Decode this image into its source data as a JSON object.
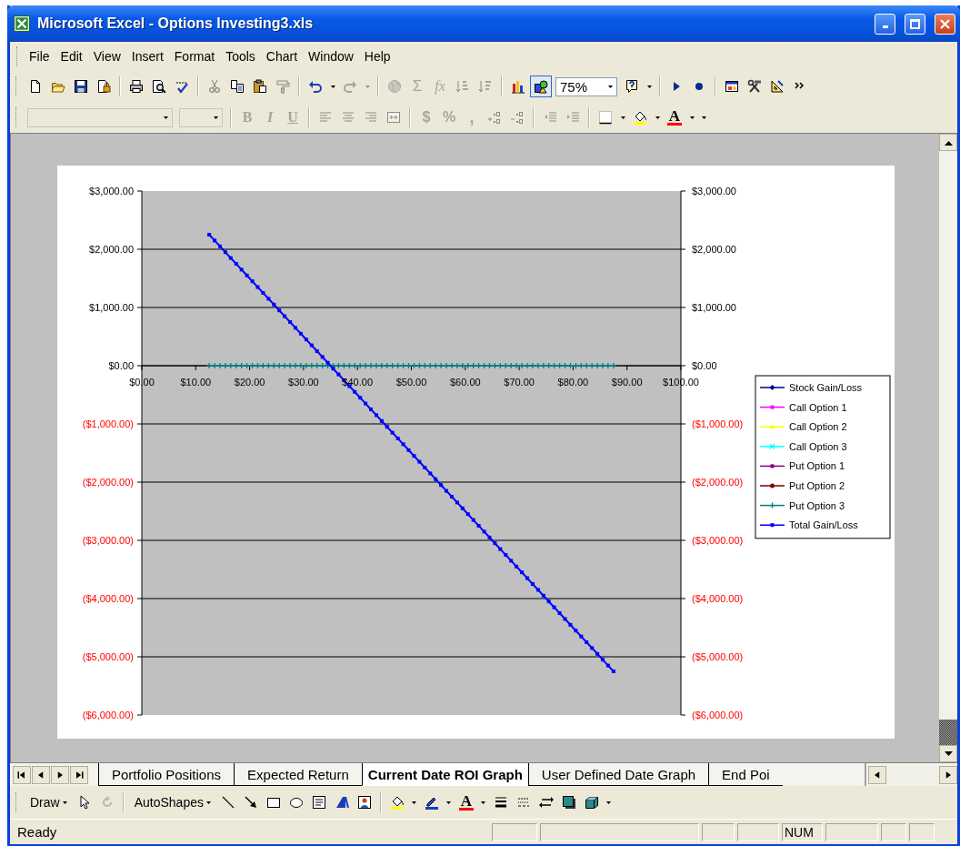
{
  "window": {
    "title": "Microsoft Excel - Options Investing3.xls"
  },
  "menu": [
    {
      "label": "File"
    },
    {
      "label": "Edit"
    },
    {
      "label": "View"
    },
    {
      "label": "Insert"
    },
    {
      "label": "Format"
    },
    {
      "label": "Tools"
    },
    {
      "label": "Chart"
    },
    {
      "label": "Window"
    },
    {
      "label": "Help"
    }
  ],
  "standard_toolbar": [
    {
      "disabled": false,
      "pressed": false
    },
    {
      "disabled": false,
      "pressed": false
    },
    {
      "disabled": false,
      "pressed": false
    },
    {
      "disabled": false,
      "pressed": false
    },
    {
      "disabled": false,
      "pressed": false
    },
    {
      "disabled": false,
      "pressed": false
    },
    {
      "disabled": false,
      "pressed": false
    },
    {
      "disabled": true,
      "pressed": false
    },
    {
      "disabled": false,
      "pressed": false
    },
    {
      "disabled": false,
      "pressed": false
    },
    {
      "disabled": true,
      "pressed": false
    },
    {
      "disabled": false,
      "pressed": false
    },
    {
      "disabled": false,
      "pressed": false
    },
    {
      "disabled": true,
      "pressed": false
    },
    {
      "disabled": true,
      "pressed": false
    },
    {
      "disabled": true,
      "pressed": false
    },
    {
      "label": "Σ",
      "disabled": true,
      "pressed": false
    },
    {
      "label": "fx",
      "disabled": true,
      "pressed": false
    },
    {
      "disabled": true,
      "pressed": false
    },
    {
      "disabled": true,
      "pressed": false
    },
    {
      "disabled": false,
      "pressed": false
    },
    {
      "disabled": false,
      "pressed": true
    },
    {
      "label": "75%",
      "disabled": false
    },
    {
      "disabled": false,
      "pressed": false
    },
    {
      "disabled": false,
      "pressed": false
    },
    {
      "disabled": false,
      "pressed": false
    },
    {
      "disabled": false,
      "pressed": false
    },
    {
      "disabled": false,
      "pressed": false
    },
    {
      "disabled": false,
      "pressed": false
    },
    {
      "disabled": false,
      "pressed": false
    },
    {
      "disabled": false,
      "pressed": false
    }
  ],
  "formatting_toolbar": [
    {
      "disabled": true
    },
    {
      "disabled": true
    },
    {
      "label": "B",
      "disabled": true
    },
    {
      "label": "I",
      "disabled": true
    },
    {
      "label": "U",
      "disabled": true
    },
    {
      "disabled": true
    },
    {
      "disabled": true
    },
    {
      "disabled": true
    },
    {
      "disabled": true
    },
    {
      "label": "$",
      "disabled": true
    },
    {
      "label": "%",
      "disabled": true
    },
    {
      "label": ",",
      "disabled": true
    },
    {
      "disabled": true
    },
    {
      "disabled": true
    },
    {
      "disabled": true
    },
    {
      "disabled": true
    },
    {
      "disabled": false
    },
    {
      "disabled": false
    },
    {
      "disabled": false
    },
    {
      "disabled": false
    },
    {
      "label": "A",
      "disabled": false
    },
    {
      "disabled": false
    },
    {
      "disabled": false
    }
  ],
  "chart": {
    "chart_data": {
      "type": "line",
      "x": [
        12.5,
        13.5,
        14.5,
        15.5,
        16.5,
        17.5,
        18.5,
        19.5,
        20.5,
        21.5,
        22.5,
        23.5,
        24.5,
        25.5,
        26.5,
        27.5,
        28.5,
        29.5,
        30.5,
        31.5,
        32.5,
        33.5,
        34.5,
        35.5,
        36.5,
        37.5,
        38.5,
        39.5,
        40.5,
        41.5,
        42.5,
        43.5,
        44.5,
        45.5,
        46.5,
        47.5,
        48.5,
        49.5,
        50.5,
        51.5,
        52.5,
        53.5,
        54.5,
        55.5,
        56.5,
        57.5,
        58.5,
        59.5,
        60.5,
        61.5,
        62.5,
        63.5,
        64.5,
        65.5,
        66.5,
        67.5,
        68.5,
        69.5,
        70.5,
        71.5,
        72.5,
        73.5,
        74.5,
        75.5,
        76.5,
        77.5,
        78.5,
        79.5,
        80.5,
        81.5,
        82.5,
        83.5,
        84.5,
        85.5,
        86.5,
        87.5
      ],
      "series": [
        {
          "name": "Stock Gain/Loss",
          "color": "#000080",
          "marker": "diamond",
          "values": [
            null,
            null,
            null,
            null,
            null,
            null,
            null,
            null,
            null,
            null,
            null,
            null,
            null,
            null,
            null,
            null,
            null,
            null,
            null,
            null,
            null,
            null,
            null,
            null,
            null,
            null,
            null,
            null,
            null,
            null,
            null,
            null,
            null,
            null,
            null,
            null,
            null,
            null,
            null,
            null,
            null,
            null,
            null,
            null,
            null,
            null,
            null,
            null,
            null,
            null,
            null,
            null,
            null,
            null,
            null,
            null,
            null,
            null,
            null,
            null,
            null,
            null,
            null,
            null,
            null,
            null,
            null,
            null,
            null,
            null,
            null,
            null,
            null,
            null,
            null,
            null
          ]
        },
        {
          "name": "Call Option 1",
          "color": "#ff00ff",
          "marker": "square",
          "values": [
            null,
            null,
            null,
            null,
            null,
            null,
            null,
            null,
            null,
            null,
            null,
            null,
            null,
            null,
            null,
            null,
            null,
            null,
            null,
            null,
            null,
            null,
            null,
            null,
            null,
            null,
            null,
            null,
            null,
            null,
            null,
            null,
            null,
            null,
            null,
            null,
            null,
            null,
            null,
            null,
            null,
            null,
            null,
            null,
            null,
            null,
            null,
            null,
            null,
            null,
            null,
            null,
            null,
            null,
            null,
            null,
            null,
            null,
            null,
            null,
            null,
            null,
            null,
            null,
            null,
            null,
            null,
            null,
            null,
            null,
            null,
            null,
            null,
            null,
            null,
            null
          ]
        },
        {
          "name": "Call Option 2",
          "color": "#ffff00",
          "marker": "triangle",
          "values": [
            null,
            null,
            null,
            null,
            null,
            null,
            null,
            null,
            null,
            null,
            null,
            null,
            null,
            null,
            null,
            null,
            null,
            null,
            null,
            null,
            null,
            null,
            null,
            null,
            null,
            null,
            null,
            null,
            null,
            null,
            null,
            null,
            null,
            null,
            null,
            null,
            null,
            null,
            null,
            null,
            null,
            null,
            null,
            null,
            null,
            null,
            null,
            null,
            null,
            null,
            null,
            null,
            null,
            null,
            null,
            null,
            null,
            null,
            null,
            null,
            null,
            null,
            null,
            null,
            null,
            null,
            null,
            null,
            null,
            null,
            null,
            null,
            null,
            null,
            null,
            null
          ]
        },
        {
          "name": "Call Option 3",
          "color": "#00ffff",
          "marker": "star",
          "values": [
            null,
            null,
            null,
            null,
            null,
            null,
            null,
            null,
            null,
            null,
            null,
            null,
            null,
            null,
            null,
            null,
            null,
            null,
            null,
            null,
            null,
            null,
            null,
            null,
            null,
            null,
            null,
            null,
            null,
            null,
            null,
            null,
            null,
            null,
            null,
            null,
            null,
            null,
            null,
            null,
            null,
            null,
            null,
            null,
            null,
            null,
            null,
            null,
            null,
            null,
            null,
            null,
            null,
            null,
            null,
            null,
            null,
            null,
            null,
            null,
            null,
            null,
            null,
            null,
            null,
            null,
            null,
            null,
            null,
            null,
            null,
            null,
            null,
            null,
            null,
            null
          ]
        },
        {
          "name": "Put Option 1",
          "color": "#800080",
          "marker": "square",
          "values": [
            null,
            null,
            null,
            null,
            null,
            null,
            null,
            null,
            null,
            null,
            null,
            null,
            null,
            null,
            null,
            null,
            null,
            null,
            null,
            null,
            null,
            null,
            null,
            null,
            null,
            null,
            null,
            null,
            null,
            null,
            null,
            null,
            null,
            null,
            null,
            null,
            null,
            null,
            null,
            null,
            null,
            null,
            null,
            null,
            null,
            null,
            null,
            null,
            null,
            null,
            null,
            null,
            null,
            null,
            null,
            null,
            null,
            null,
            null,
            null,
            null,
            null,
            null,
            null,
            null,
            null,
            null,
            null,
            null,
            null,
            null,
            null,
            null,
            null,
            null,
            null
          ]
        },
        {
          "name": "Put Option 2",
          "color": "#800000",
          "marker": "circle",
          "values": [
            null,
            null,
            null,
            null,
            null,
            null,
            null,
            null,
            null,
            null,
            null,
            null,
            null,
            null,
            null,
            null,
            null,
            null,
            null,
            null,
            null,
            null,
            null,
            null,
            null,
            null,
            null,
            null,
            null,
            null,
            null,
            null,
            null,
            null,
            null,
            null,
            null,
            null,
            null,
            null,
            null,
            null,
            null,
            null,
            null,
            null,
            null,
            null,
            null,
            null,
            null,
            null,
            null,
            null,
            null,
            null,
            null,
            null,
            null,
            null,
            null,
            null,
            null,
            null,
            null,
            null,
            null,
            null,
            null,
            null,
            null,
            null,
            null,
            null,
            null,
            null
          ]
        },
        {
          "name": "Put Option 3",
          "color": "#008080",
          "marker": "cross",
          "values": [
            0,
            0,
            0,
            0,
            0,
            0,
            0,
            0,
            0,
            0,
            0,
            0,
            0,
            0,
            0,
            0,
            0,
            0,
            0,
            0,
            0,
            0,
            0,
            0,
            0,
            0,
            0,
            0,
            0,
            0,
            0,
            0,
            0,
            0,
            0,
            0,
            0,
            0,
            0,
            0,
            0,
            0,
            0,
            0,
            0,
            0,
            0,
            0,
            0,
            0,
            0,
            0,
            0,
            0,
            0,
            0,
            0,
            0,
            0,
            0,
            0,
            0,
            0,
            0,
            0,
            0,
            0,
            0,
            0,
            0,
            0,
            0,
            0,
            0,
            0,
            0
          ]
        },
        {
          "name": "Total Gain/Loss",
          "color": "#0000ff",
          "marker": "square",
          "values": [
            2250,
            2150,
            2050,
            1950,
            1850,
            1750,
            1650,
            1550,
            1450,
            1350,
            1250,
            1150,
            1050,
            950,
            850,
            750,
            650,
            550,
            450,
            350,
            250,
            150,
            50,
            -50,
            -150,
            -250,
            -350,
            -450,
            -550,
            -650,
            -750,
            -850,
            -950,
            -1050,
            -1150,
            -1250,
            -1350,
            -1450,
            -1550,
            -1650,
            -1750,
            -1850,
            -1950,
            -2050,
            -2150,
            -2250,
            -2350,
            -2450,
            -2550,
            -2650,
            -2750,
            -2850,
            -2950,
            -3050,
            -3150,
            -3250,
            -3350,
            -3450,
            -3550,
            -3650,
            -3750,
            -3850,
            -3950,
            -4050,
            -4150,
            -4250,
            -4350,
            -4450,
            -4550,
            -4650,
            -4750,
            -4850,
            -4950,
            -5050,
            -5150,
            -5250
          ]
        }
      ],
      "xlim": [
        0,
        100
      ],
      "ylim": [
        -6000,
        3000
      ],
      "y2lim": [
        -6000,
        3000
      ],
      "grid": true,
      "legend": "right",
      "xticks": [
        {
          "value": 0,
          "label": "$0.00"
        },
        {
          "value": 10,
          "label": "$10.00"
        },
        {
          "value": 20,
          "label": "$20.00"
        },
        {
          "value": 30,
          "label": "$30.00"
        },
        {
          "value": 40,
          "label": "$40.00"
        },
        {
          "value": 50,
          "label": "$50.00"
        },
        {
          "value": 60,
          "label": "$60.00"
        },
        {
          "value": 70,
          "label": "$70.00"
        },
        {
          "value": 80,
          "label": "$80.00"
        },
        {
          "value": 90,
          "label": "$90.00"
        },
        {
          "value": 100,
          "label": "$100.00"
        }
      ],
      "yticks": [
        {
          "value": 3000,
          "label": "$3,000.00"
        },
        {
          "value": 2000,
          "label": "$2,000.00"
        },
        {
          "value": 1000,
          "label": "$1,000.00"
        },
        {
          "value": 0,
          "label": "$0.00"
        },
        {
          "value": -1000,
          "label": "($1,000.00)"
        },
        {
          "value": -2000,
          "label": "($2,000.00)"
        },
        {
          "value": -3000,
          "label": "($3,000.00)"
        },
        {
          "value": -4000,
          "label": "($4,000.00)"
        },
        {
          "value": -5000,
          "label": "($5,000.00)"
        },
        {
          "value": -6000,
          "label": "($6,000.00)"
        }
      ],
      "y2ticks": [
        {
          "value": 3000,
          "label": "$3,000.00"
        },
        {
          "value": 2000,
          "label": "$2,000.00"
        },
        {
          "value": 1000,
          "label": "$1,000.00"
        },
        {
          "value": 0,
          "label": "$0.00"
        },
        {
          "value": -1000,
          "label": "($1,000.00)"
        },
        {
          "value": -2000,
          "label": "($2,000.00)"
        },
        {
          "value": -3000,
          "label": "($3,000.00)"
        },
        {
          "value": -4000,
          "label": "($4,000.00)"
        },
        {
          "value": -5000,
          "label": "($5,000.00)"
        },
        {
          "value": -6000,
          "label": "($6,000.00)"
        }
      ]
    }
  },
  "sheet_tabs": [
    {
      "label": "Portfolio Positions",
      "selected": false
    },
    {
      "label": "Expected Return",
      "selected": false
    },
    {
      "label": "Current Date ROI Graph",
      "selected": true
    },
    {
      "label": "User Defined Date Graph",
      "selected": false
    },
    {
      "label": "End Poi",
      "selected": false
    }
  ],
  "drawing_toolbar": [
    {
      "label": "Draw",
      "disabled": false
    },
    {
      "disabled": false
    },
    {
      "disabled": true
    },
    {
      "label": "AutoShapes",
      "disabled": false
    },
    {
      "disabled": false
    },
    {
      "disabled": false
    },
    {
      "disabled": false
    },
    {
      "disabled": false
    },
    {
      "disabled": false
    },
    {
      "disabled": false
    },
    {
      "disabled": false
    },
    {
      "disabled": false
    },
    {
      "disabled": false
    },
    {
      "disabled": false
    },
    {
      "disabled": false
    },
    {
      "label": "A",
      "disabled": false
    },
    {
      "disabled": false
    },
    {
      "disabled": false
    },
    {
      "disabled": false
    },
    {
      "disabled": false
    },
    {
      "disabled": false
    },
    {
      "disabled": false
    },
    {
      "disabled": false
    }
  ],
  "status_bar": {
    "text": "Ready",
    "indicators": [
      "NUM"
    ]
  }
}
